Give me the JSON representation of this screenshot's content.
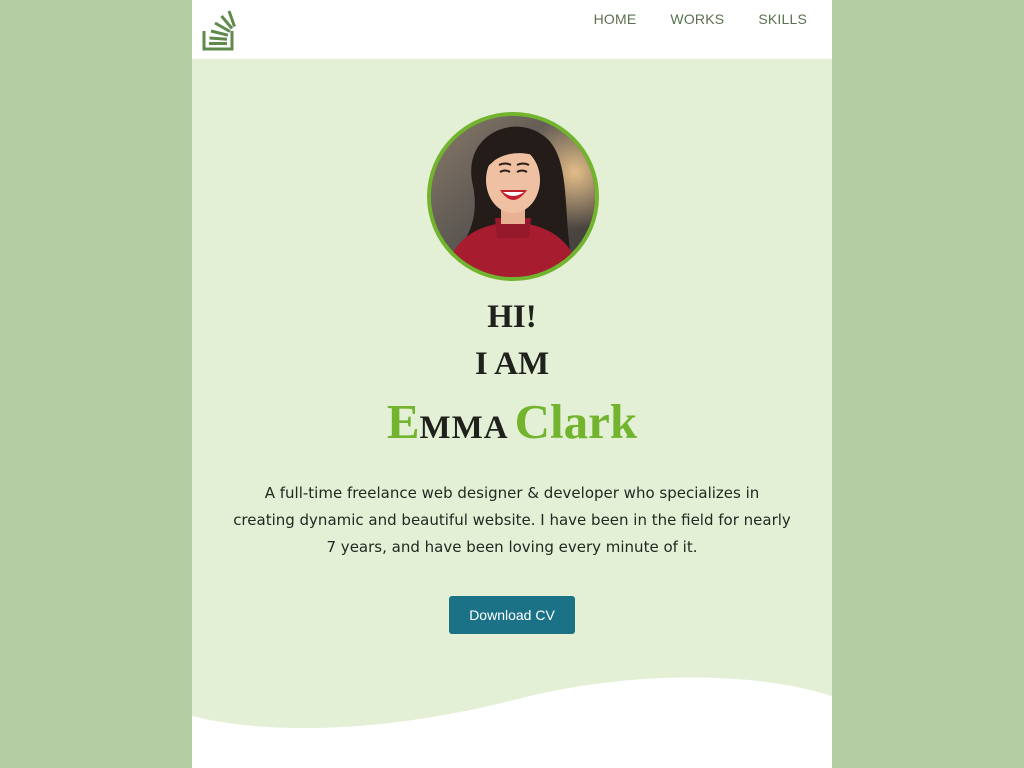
{
  "nav": {
    "items": [
      {
        "label": "HOME"
      },
      {
        "label": "WORKS"
      },
      {
        "label": "SKILLS"
      }
    ]
  },
  "logo": {
    "icon": "stack-overflow-icon"
  },
  "hero": {
    "greeting": "HI!",
    "intro": "I AM",
    "first_initial": "E",
    "first_rest": "MMA",
    "last_name": "Clark",
    "bio": "A full-time freelance web designer & developer who specializes in creating dynamic and beautiful website. I have been in the field for nearly 7 years, and have been loving every minute of it.",
    "cta_label": "Download CV"
  },
  "colors": {
    "outer_background": "#b4cea2",
    "page_background": "#e4f0d6",
    "accent_green": "#72b42e",
    "button": "#1b7286",
    "nav_text": "#5a7250"
  }
}
